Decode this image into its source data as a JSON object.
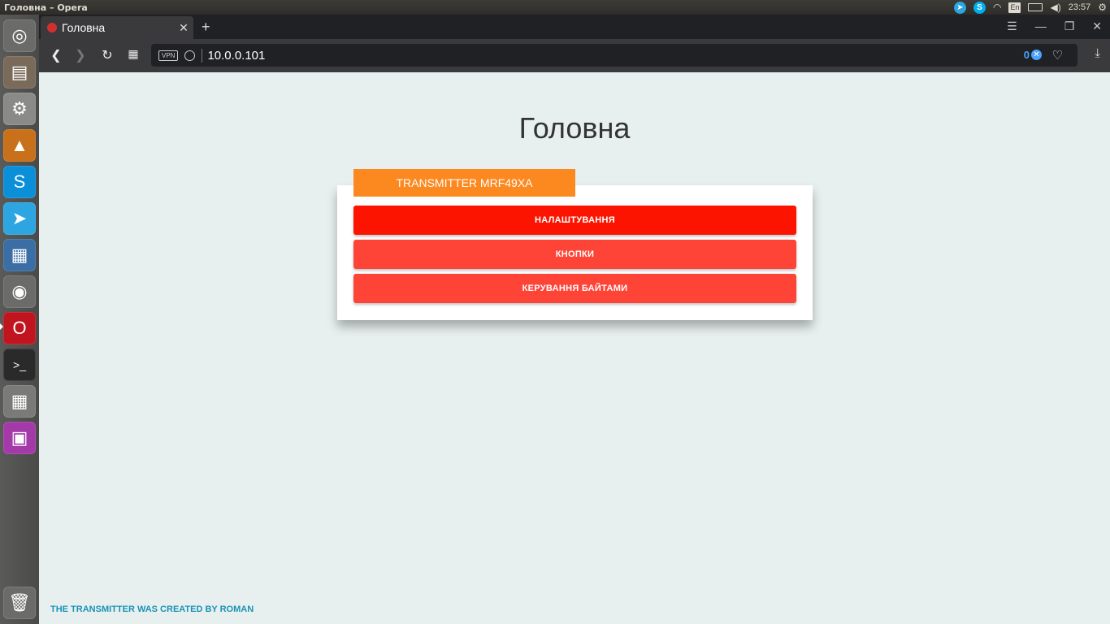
{
  "system": {
    "window_title": "Головна – Opera",
    "lang_indicator": "En",
    "clock": "23:57"
  },
  "browser": {
    "tab_label": "Головна",
    "url": "10.0.0.101",
    "vpn_label": "VPN",
    "adblock_count": "0"
  },
  "page": {
    "heading": "Головна",
    "card_tag": "TRANSMITTER MRF49XA",
    "buttons": [
      {
        "label": "НАЛАШТУВАННЯ"
      },
      {
        "label": "КНОПКИ"
      },
      {
        "label": "КЕРУВАННЯ БАЙТАМИ"
      }
    ],
    "footer": "THE TRANSMITTER WAS CREATED BY ROMAN"
  },
  "launcher": {
    "apps": [
      "ubuntu-dash-icon",
      "files-icon",
      "system-settings-icon",
      "vlc-icon",
      "skype-icon",
      "telegram-icon",
      "writer-icon",
      "chrome-icon",
      "opera-icon",
      "terminal-icon",
      "calculator-icon",
      "remote-desktop-icon",
      "trash-icon"
    ]
  },
  "colors": {
    "accent_orange": "#fc8820",
    "button_primary": "#fd1400",
    "button_secondary": "#fd4437",
    "page_background": "#e8f0ef",
    "footer_text": "#1a92b6"
  }
}
